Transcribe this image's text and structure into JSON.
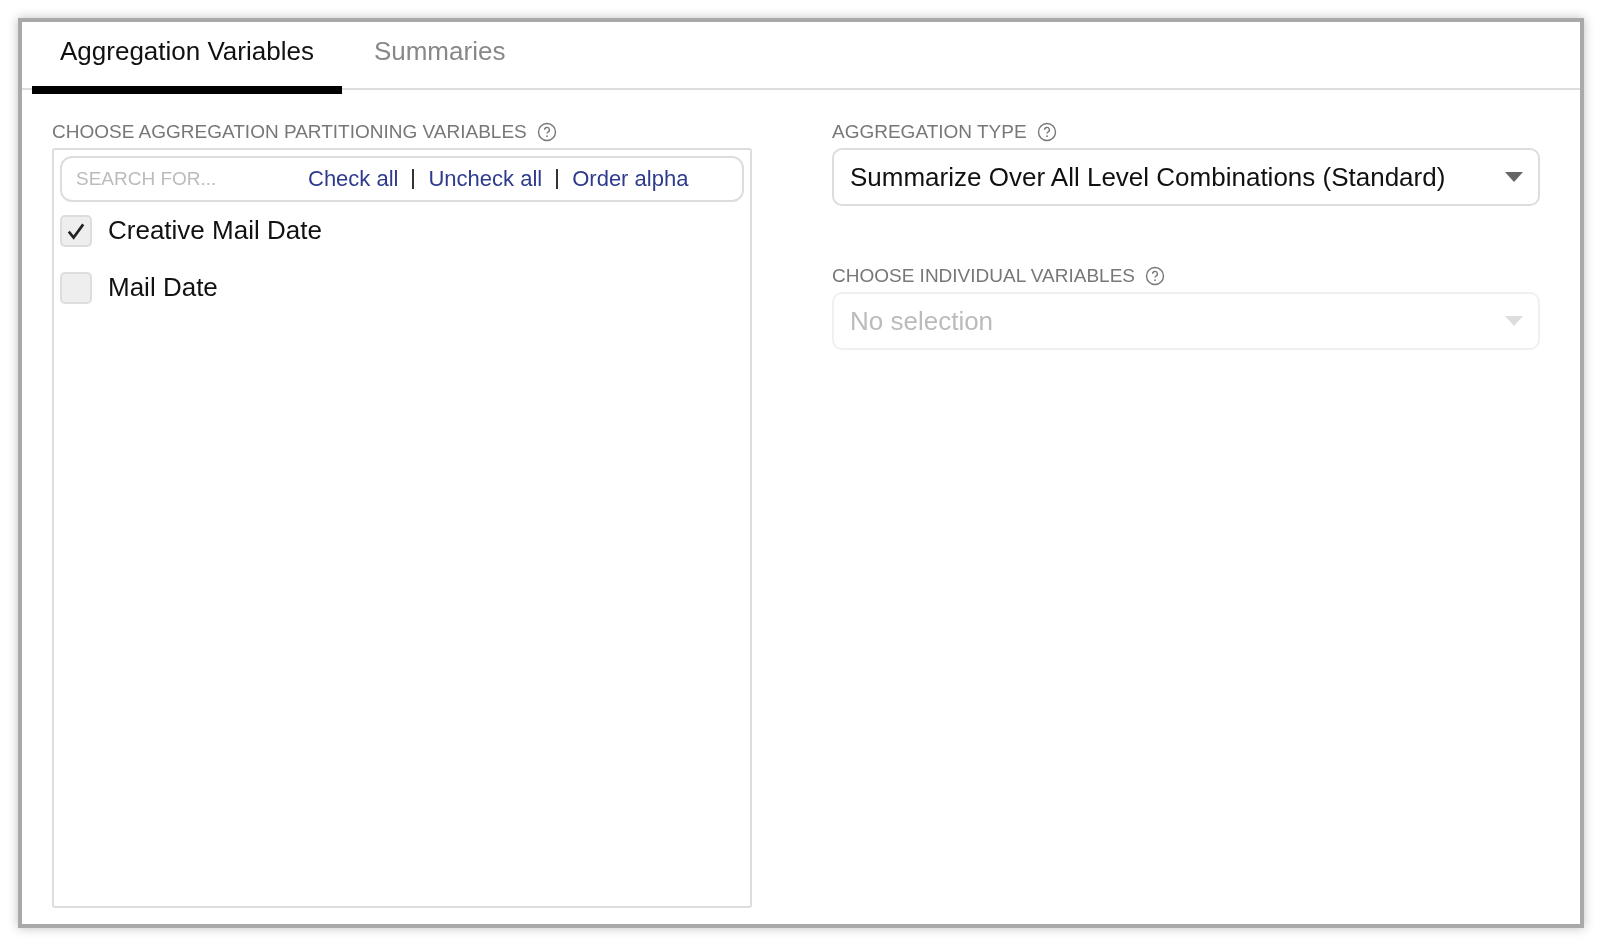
{
  "tabs": [
    {
      "label": "Aggregation Variables",
      "selected": true
    },
    {
      "label": "Summaries",
      "selected": false
    }
  ],
  "partitioning": {
    "label": "CHOOSE AGGREGATION PARTITIONING VARIABLES",
    "search": {
      "placeholder": "SEARCH FOR..."
    },
    "actions": [
      "Check all",
      "Uncheck all",
      "Order alpha"
    ],
    "items": [
      {
        "label": "Creative Mail Date",
        "checked": true
      },
      {
        "label": "Mail Date",
        "checked": false
      }
    ]
  },
  "aggregation_type": {
    "label": "AGGREGATION TYPE",
    "value": "Summarize Over All Level Combinations (Standard)",
    "disabled": false
  },
  "individual_variables": {
    "label": "CHOOSE INDIVIDUAL VARIABLES",
    "placeholder": "No selection",
    "disabled": true
  }
}
